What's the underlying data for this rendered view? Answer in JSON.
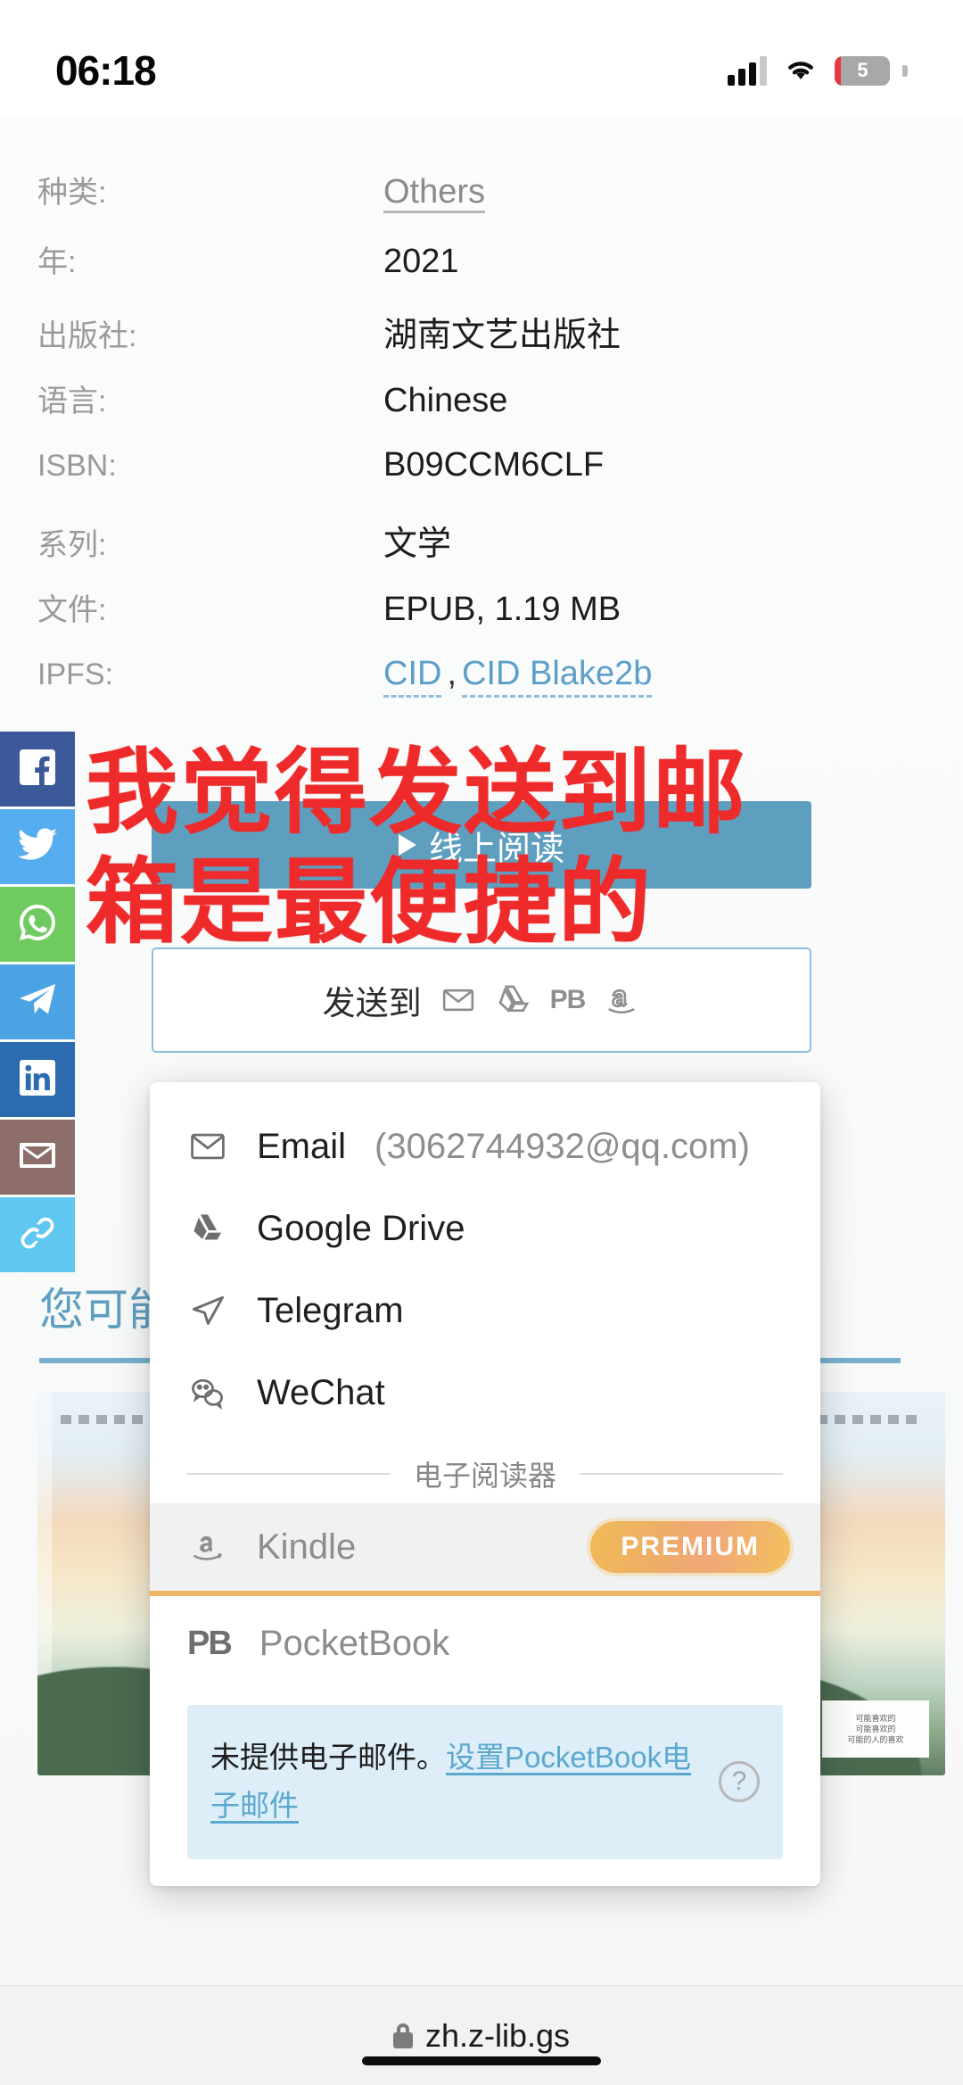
{
  "status_bar": {
    "time": "06:18",
    "battery_level": "5",
    "icons": [
      "cellular-signal-icon",
      "wifi-icon",
      "battery-charging-icon"
    ]
  },
  "metadata": {
    "rows": [
      {
        "key": "种类:",
        "value": "Others",
        "type": "link"
      },
      {
        "key": "年:",
        "value": "2021",
        "type": "text"
      },
      {
        "key": "出版社:",
        "value": "湖南文艺出版社",
        "type": "text"
      },
      {
        "key": "语言:",
        "value": "Chinese",
        "type": "text"
      },
      {
        "key": "ISBN:",
        "value": "B09CCM6CLF",
        "type": "text"
      },
      {
        "key": "系列:",
        "value": "文学",
        "type": "text"
      },
      {
        "key": "文件:",
        "value": "EPUB, 1.19 MB",
        "type": "text"
      }
    ],
    "ipfs": {
      "key": "IPFS:",
      "link1": "CID",
      "separator": ",",
      "link2": "CID Blake2b"
    }
  },
  "social_rail": {
    "items": [
      {
        "name": "facebook",
        "label": "Facebook",
        "color": "#3b5998"
      },
      {
        "name": "twitter",
        "label": "Twitter",
        "color": "#55acee"
      },
      {
        "name": "whatsapp",
        "label": "WhatsApp",
        "color": "#6fcb60"
      },
      {
        "name": "telegram",
        "label": "Telegram",
        "color": "#4ba3e3"
      },
      {
        "name": "linkedin",
        "label": "LinkedIn",
        "color": "#2c6bad"
      },
      {
        "name": "email",
        "label": "Email",
        "color": "#8c6d68"
      },
      {
        "name": "link",
        "label": "Copy link",
        "color": "#5fc7f0"
      }
    ]
  },
  "actions": {
    "read_online": "线上阅读",
    "send_to": "发送到",
    "send_to_icons": [
      "email-icon",
      "google-drive-icon",
      "pocketbook-icon",
      "kindle-icon"
    ],
    "read_button_color": "#5e9fc0"
  },
  "dropdown": {
    "items": [
      {
        "icon": "email-icon",
        "label": "Email",
        "sub": "(3062744932@qq.com)"
      },
      {
        "icon": "google-drive-icon",
        "label": "Google Drive",
        "sub": ""
      },
      {
        "icon": "telegram-icon",
        "label": "Telegram",
        "sub": ""
      },
      {
        "icon": "wechat-icon",
        "label": "WeChat",
        "sub": ""
      }
    ],
    "section_divider": "电子阅读器",
    "kindle": {
      "icon": "amazon-icon",
      "label": "Kindle",
      "badge": "PREMIUM"
    },
    "pocketbook": {
      "icon": "pocketbook-icon",
      "label": "PocketBook"
    },
    "notice": {
      "text": "未提供电子邮件。",
      "link": "设置PocketBook电子邮件",
      "help_icon": "question-mark-icon"
    }
  },
  "suggestions": {
    "heading": "您可能",
    "covers": [
      "book-cover-1",
      "book-cover-2",
      "book-cover-3"
    ],
    "cover_tag_text": "可能喜欢的\n可能喜欢的\n可能的人的喜欢的"
  },
  "annotation": {
    "line1": "我觉得发送到邮",
    "line2": "箱是最便捷的",
    "color": "#ee2a2a"
  },
  "browser": {
    "url": "zh.z-lib.gs",
    "lock_icon": "lock-icon"
  }
}
